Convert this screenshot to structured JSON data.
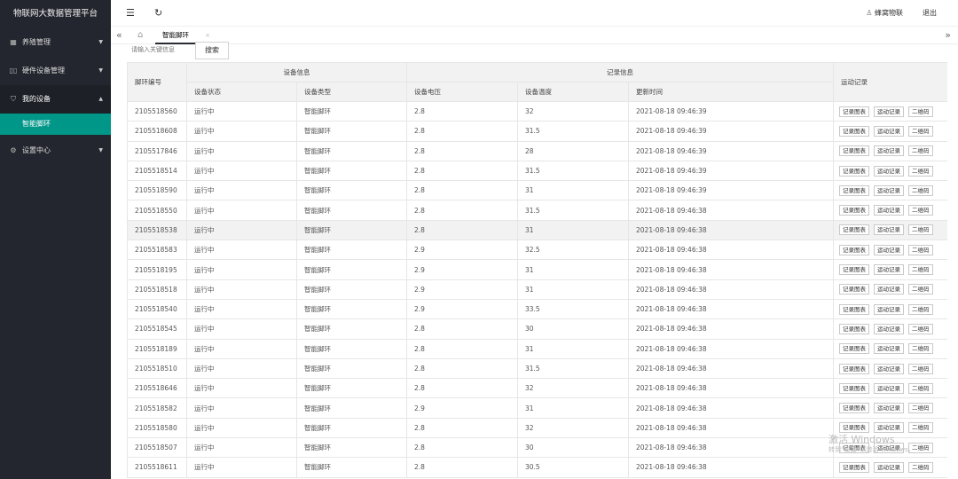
{
  "app": {
    "title": "物联网大数据管理平台"
  },
  "sidebar": {
    "items": [
      {
        "label": "养殖管理",
        "icon": "grid-icon"
      },
      {
        "label": "硬件设备管理",
        "icon": "device-icon"
      },
      {
        "label": "我的设备",
        "icon": "shield-icon",
        "children": [
          {
            "label": "智能脚环"
          }
        ]
      },
      {
        "label": "设置中心",
        "icon": "gear-icon"
      }
    ]
  },
  "header": {
    "user": "蜂窝物联",
    "logout": "退出"
  },
  "tabs": [
    {
      "label": "智能脚环",
      "close": "×"
    }
  ],
  "search": {
    "placeholder": "请输入关键信息",
    "button": "搜索"
  },
  "table": {
    "col_id": "脚环编号",
    "group_device": "设备信息",
    "group_record": "记录信息",
    "col_ops": "运动记录",
    "sub_cols": [
      "设备状态",
      "设备类型",
      "设备电压",
      "设备温度",
      "更新时间"
    ],
    "op_labels": [
      "记录图表",
      "运动记录",
      "二维码"
    ],
    "hover_row_index": 6,
    "rows": [
      [
        "2105518560",
        "运行中",
        "智能脚环",
        "2.8",
        "32",
        "2021-08-18 09:46:39"
      ],
      [
        "2105518608",
        "运行中",
        "智能脚环",
        "2.8",
        "31.5",
        "2021-08-18 09:46:39"
      ],
      [
        "2105517846",
        "运行中",
        "智能脚环",
        "2.8",
        "28",
        "2021-08-18 09:46:39"
      ],
      [
        "2105518514",
        "运行中",
        "智能脚环",
        "2.8",
        "31.5",
        "2021-08-18 09:46:39"
      ],
      [
        "2105518590",
        "运行中",
        "智能脚环",
        "2.8",
        "31",
        "2021-08-18 09:46:39"
      ],
      [
        "2105518550",
        "运行中",
        "智能脚环",
        "2.8",
        "31.5",
        "2021-08-18 09:46:38"
      ],
      [
        "2105518538",
        "运行中",
        "智能脚环",
        "2.8",
        "31",
        "2021-08-18 09:46:38"
      ],
      [
        "2105518583",
        "运行中",
        "智能脚环",
        "2.9",
        "32.5",
        "2021-08-18 09:46:38"
      ],
      [
        "2105518195",
        "运行中",
        "智能脚环",
        "2.9",
        "31",
        "2021-08-18 09:46:38"
      ],
      [
        "2105518518",
        "运行中",
        "智能脚环",
        "2.9",
        "31",
        "2021-08-18 09:46:38"
      ],
      [
        "2105518540",
        "运行中",
        "智能脚环",
        "2.9",
        "33.5",
        "2021-08-18 09:46:38"
      ],
      [
        "2105518545",
        "运行中",
        "智能脚环",
        "2.8",
        "30",
        "2021-08-18 09:46:38"
      ],
      [
        "2105518189",
        "运行中",
        "智能脚环",
        "2.8",
        "31",
        "2021-08-18 09:46:38"
      ],
      [
        "2105518510",
        "运行中",
        "智能脚环",
        "2.8",
        "31.5",
        "2021-08-18 09:46:38"
      ],
      [
        "2105518646",
        "运行中",
        "智能脚环",
        "2.8",
        "32",
        "2021-08-18 09:46:38"
      ],
      [
        "2105518582",
        "运行中",
        "智能脚环",
        "2.9",
        "31",
        "2021-08-18 09:46:38"
      ],
      [
        "2105518580",
        "运行中",
        "智能脚环",
        "2.8",
        "32",
        "2021-08-18 09:46:38"
      ],
      [
        "2105518507",
        "运行中",
        "智能脚环",
        "2.8",
        "30",
        "2021-08-18 09:46:38"
      ],
      [
        "2105518611",
        "运行中",
        "智能脚环",
        "2.8",
        "30.5",
        "2021-08-18 09:46:38"
      ]
    ]
  },
  "watermark": {
    "line1": "激活 Windows",
    "line2": "转到“设置”以激活 Windows。"
  },
  "colors": {
    "sidebar_bg": "#23262e",
    "active_item": "#009688",
    "header_bg": "#f2f2f2"
  }
}
